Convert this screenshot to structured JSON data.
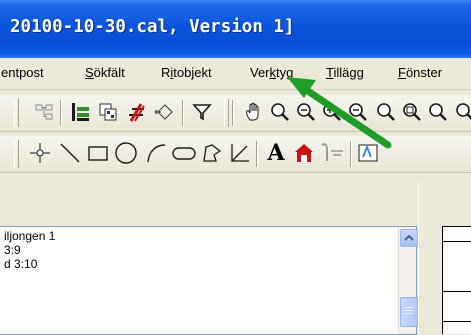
{
  "window": {
    "title": "20100-10-30.cal, Version 1]"
  },
  "menubar": {
    "items": [
      {
        "pre": "",
        "u": "",
        "rest": "entpost"
      },
      {
        "pre": "",
        "u": "S",
        "rest": "ökfält"
      },
      {
        "pre": "R",
        "u": "i",
        "rest": "tobjekt"
      },
      {
        "pre": "Ver",
        "u": "k",
        "rest": "tyg"
      },
      {
        "pre": "",
        "u": "T",
        "rest": "illägg"
      },
      {
        "pre": "",
        "u": "F",
        "rest": "önster"
      }
    ]
  },
  "toolbar1": {
    "icons": [
      "layer-tree-icon",
      "green-layer-icon",
      "copy-layers-icon",
      "red-tool-icon",
      "node-arrows-icon",
      "filter-icon",
      "pan-hand-icon",
      "zoom-icon",
      "zoom-minus-icon",
      "zoom-in-icon",
      "zoom-out-icon"
    ]
  },
  "toolbar2": {
    "icons": [
      "point-icon",
      "line-icon",
      "rectangle-icon",
      "ellipse-icon",
      "arc-icon",
      "rounded-shape-icon",
      "freehand-icon",
      "angle-icon",
      "text-icon",
      "house-symbol-icon",
      "gray-symbol-icon",
      "text-box-icon"
    ],
    "text_tool_label": "A"
  },
  "list": {
    "items": [
      "iljongen 1",
      "3:9",
      "d 3:10"
    ]
  },
  "colors": {
    "title_blue": "#0b55dc",
    "arrow_green": "#1e9e28",
    "red_mark": "#d01010"
  }
}
